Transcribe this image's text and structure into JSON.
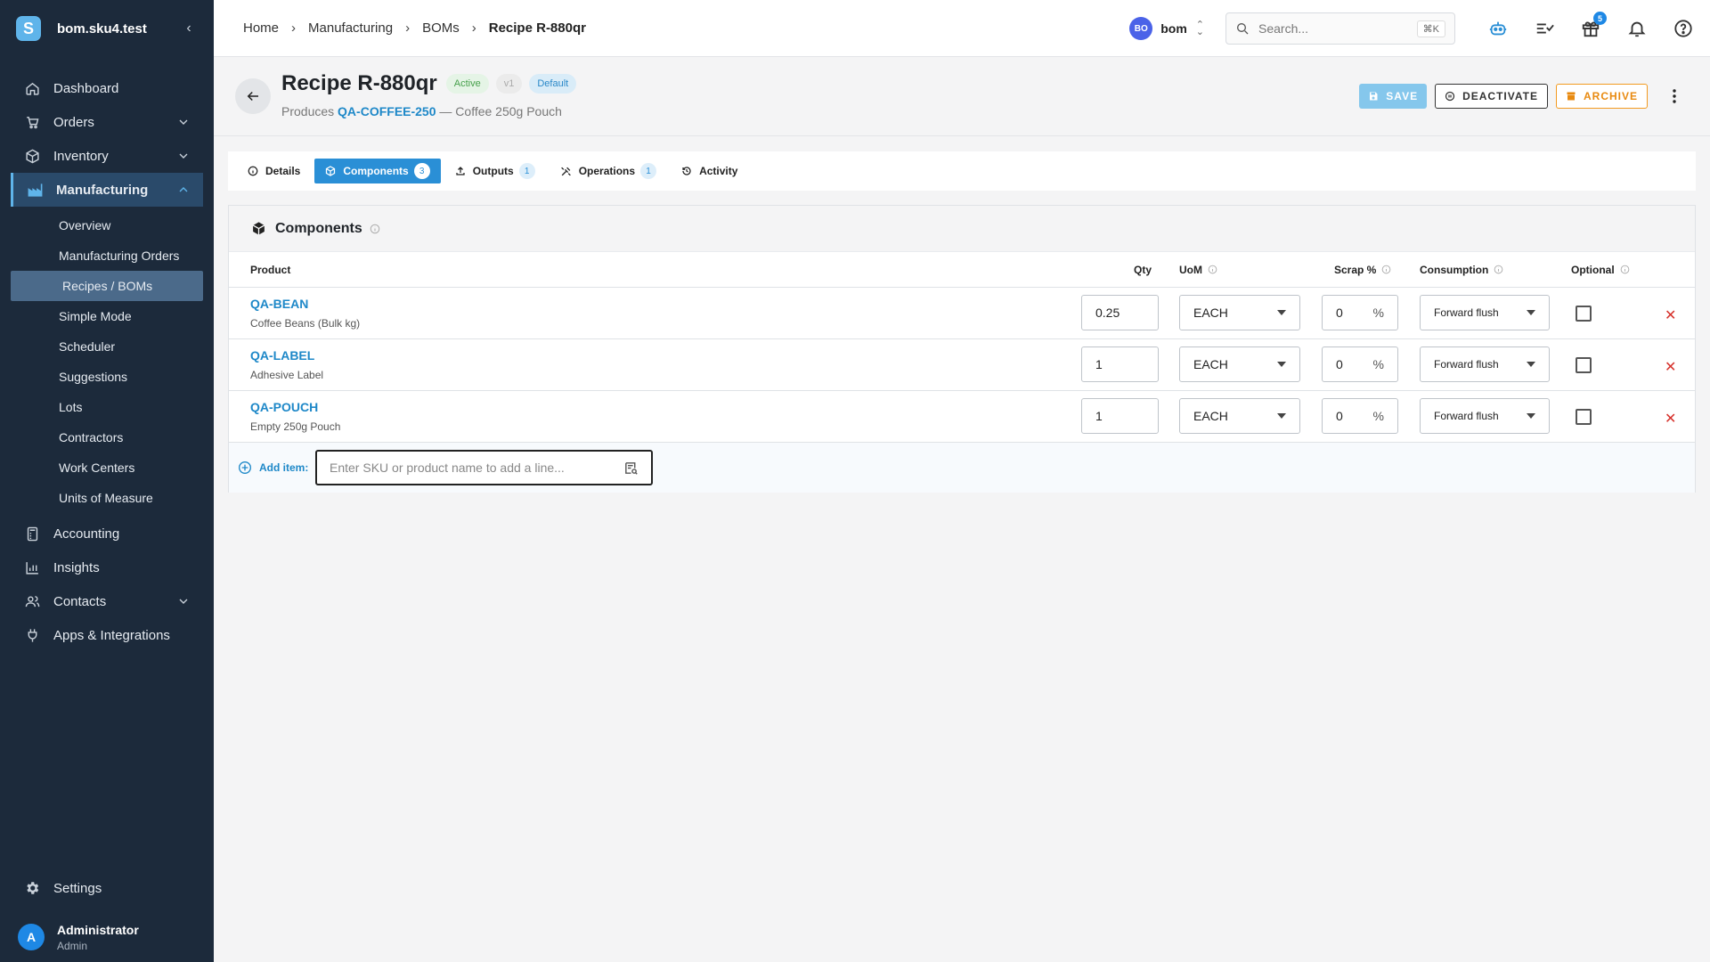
{
  "brand": {
    "logo_letter": "S",
    "name": "bom.sku4.test"
  },
  "nav": {
    "items": [
      {
        "label": "Dashboard",
        "icon": "home-icon"
      },
      {
        "label": "Orders",
        "icon": "cart-icon"
      },
      {
        "label": "Inventory",
        "icon": "box-icon"
      },
      {
        "label": "Manufacturing",
        "icon": "factory-icon"
      }
    ],
    "sub_items": [
      "Overview",
      "Manufacturing Orders",
      "Recipes / BOMs",
      "Simple Mode",
      "Scheduler",
      "Suggestions",
      "Lots",
      "Contractors",
      "Work Centers",
      "Units of Measure"
    ],
    "items_after": [
      {
        "label": "Accounting",
        "icon": "calculator-icon"
      },
      {
        "label": "Insights",
        "icon": "chart-icon"
      },
      {
        "label": "Contacts",
        "icon": "contacts-icon"
      },
      {
        "label": "Apps & Integrations",
        "icon": "plug-icon"
      }
    ],
    "settings": "Settings"
  },
  "user": {
    "initial": "A",
    "name": "Administrator",
    "role": "Admin"
  },
  "breadcrumbs": [
    "Home",
    "Manufacturing",
    "BOMs",
    "Recipe R-880qr"
  ],
  "workspace": {
    "initials": "BO",
    "name": "bom"
  },
  "search": {
    "placeholder": "Search...",
    "shortcut": "⌘K"
  },
  "notifications": {
    "gift_count": "5"
  },
  "header": {
    "title": "Recipe R-880qr",
    "status": "Active",
    "version": "v1",
    "default_label": "Default",
    "produces_prefix": "Produces",
    "produces_sku": "QA-COFFEE-250",
    "produces_name": "— Coffee 250g Pouch"
  },
  "actions": {
    "save": "SAVE",
    "deactivate": "DEACTIVATE",
    "archive": "ARCHIVE"
  },
  "tabs": [
    {
      "label": "Details",
      "count": ""
    },
    {
      "label": "Components",
      "count": "3"
    },
    {
      "label": "Outputs",
      "count": "1"
    },
    {
      "label": "Operations",
      "count": "1"
    },
    {
      "label": "Activity",
      "count": ""
    }
  ],
  "components": {
    "title": "Components",
    "columns": {
      "product": "Product",
      "qty": "Qty",
      "uom": "UoM",
      "scrap": "Scrap %",
      "consumption": "Consumption",
      "optional": "Optional"
    },
    "rows": [
      {
        "sku": "QA-BEAN",
        "name": "Coffee Beans (Bulk kg)",
        "qty": "0.25",
        "uom": "EACH",
        "scrap": "0",
        "consumption": "Forward flush",
        "optional": false
      },
      {
        "sku": "QA-LABEL",
        "name": "Adhesive Label",
        "qty": "1",
        "uom": "EACH",
        "scrap": "0",
        "consumption": "Forward flush",
        "optional": false
      },
      {
        "sku": "QA-POUCH",
        "name": "Empty 250g Pouch",
        "qty": "1",
        "uom": "EACH",
        "scrap": "0",
        "consumption": "Forward flush",
        "optional": false
      }
    ],
    "percent_sign": "%",
    "add_label": "Add item:",
    "add_placeholder": "Enter SKU or product name to add a line..."
  },
  "colors": {
    "sidebar": "#1c2a3b",
    "accent": "#2a8fd6",
    "archive": "#e88a10",
    "danger": "#d6312b"
  }
}
